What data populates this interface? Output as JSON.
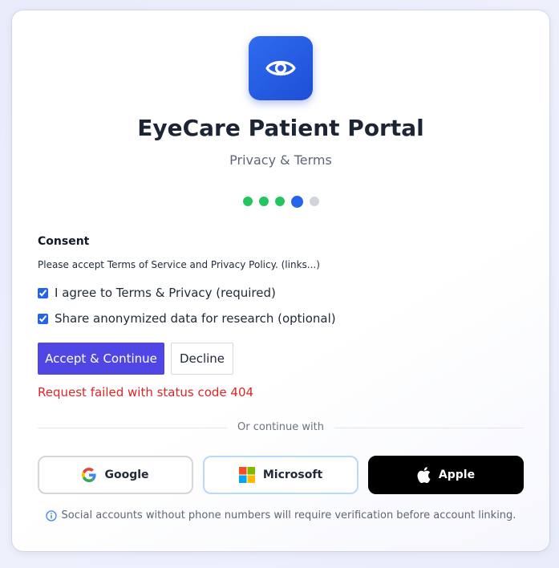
{
  "app": {
    "title": "EyeCare Patient Portal",
    "subtitle": "Privacy & Terms"
  },
  "steps": {
    "total": 5,
    "current": 4,
    "colors": {
      "done": "#22c55e",
      "current": "#2563eb",
      "todo": "#d1d5db"
    }
  },
  "consent": {
    "heading": "Consent",
    "text": "Please accept Terms of Service and Privacy Policy. (links...)",
    "terms_label": "I agree to Terms & Privacy (required)",
    "terms_checked": true,
    "research_label": "Share anonymized data for research (optional)",
    "research_checked": true
  },
  "actions": {
    "accept_label": "Accept & Continue",
    "decline_label": "Decline"
  },
  "error": {
    "message": "Request failed with status code 404"
  },
  "social": {
    "divider_text": "Or continue with",
    "google_label": "Google",
    "microsoft_label": "Microsoft",
    "apple_label": "Apple",
    "note": "Social accounts without phone numbers will require verification before account linking."
  },
  "icons": {
    "logo": "eye-icon",
    "google": "google-icon",
    "microsoft": "microsoft-icon",
    "apple": "apple-icon",
    "note": "info-icon"
  },
  "colors": {
    "accent": "#4f46e5",
    "brand": "#2563eb",
    "error": "#dc2626"
  }
}
